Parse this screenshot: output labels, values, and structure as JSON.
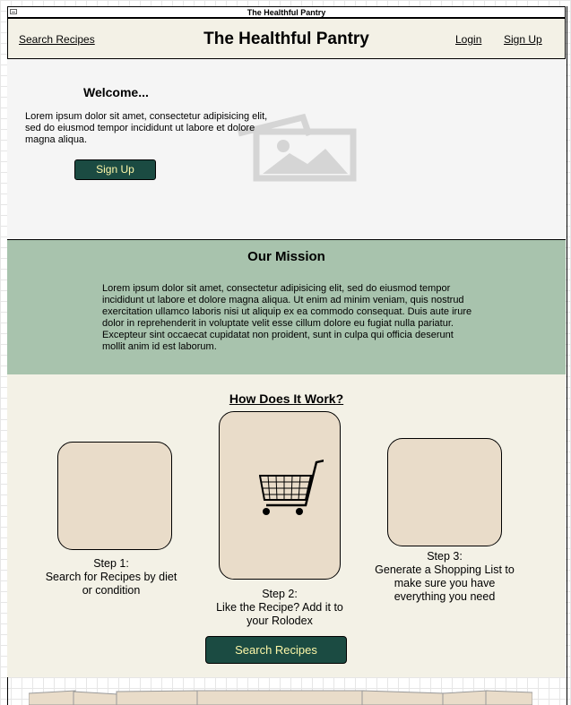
{
  "window": {
    "title": "The Healthful Pantry"
  },
  "header": {
    "search_link": "Search Recipes",
    "brand": "The Healthful Pantry",
    "login": "Login",
    "signup": "Sign Up"
  },
  "hero": {
    "welcome": "Welcome...",
    "text": "Lorem ipsum dolor sit amet, consectetur adipisicing elit, sed do eiusmod tempor incididunt ut labore et dolore magna aliqua.",
    "signup_button": "Sign Up",
    "image_icon": "image-placeholder-icon"
  },
  "mission": {
    "title": "Our Mission",
    "text": "Lorem ipsum dolor sit amet, consectetur adipisicing elit, sed do eiusmod tempor incididunt ut labore et dolore magna aliqua. Ut enim ad minim veniam, quis nostrud exercitation ullamco laboris nisi ut aliquip ex ea commodo consequat. Duis aute irure dolor in reprehenderit in voluptate velit esse cillum dolore eu fugiat nulla pariatur. Excepteur sint occaecat cupidatat non proident, sunt in culpa qui officia deserunt mollit anim id est laborum."
  },
  "how": {
    "title": "How Does It Work?",
    "steps": [
      {
        "label": "Step 1:",
        "text": "Search for Recipes by diet or condition"
      },
      {
        "label": "Step 2:",
        "text": "Like the Recipe? Add it to your Rolodex"
      },
      {
        "label": "Step 3:",
        "text": "Generate a Shopping List to make sure you have everything you need"
      }
    ],
    "cart_icon": "shopping-cart-icon",
    "button": "Search Recipes"
  },
  "colors": {
    "button_bg": "#1b4b42",
    "button_text": "#fdf7a8",
    "header_bg": "#f3f1e6",
    "mission_bg": "#a8c3ad",
    "card_bg": "#e9dcc9"
  }
}
